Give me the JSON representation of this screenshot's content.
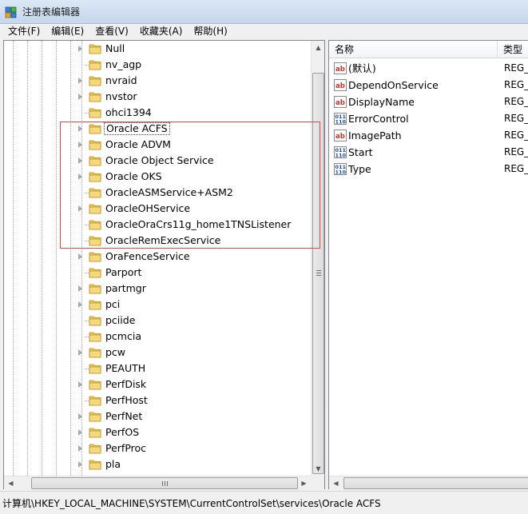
{
  "window": {
    "title": "注册表编辑器"
  },
  "menu": [
    "文件(F)",
    "编辑(E)",
    "查看(V)",
    "收藏夹(A)",
    "帮助(H)"
  ],
  "tree": {
    "items": [
      {
        "label": "Null",
        "expandable": true
      },
      {
        "label": "nv_agp",
        "expandable": false
      },
      {
        "label": "nvraid",
        "expandable": true
      },
      {
        "label": "nvstor",
        "expandable": true
      },
      {
        "label": "ohci1394",
        "expandable": false
      },
      {
        "label": "Oracle ACFS",
        "expandable": true,
        "selected": true
      },
      {
        "label": "Oracle ADVM",
        "expandable": true
      },
      {
        "label": "Oracle Object Service",
        "expandable": true
      },
      {
        "label": "Oracle OKS",
        "expandable": true
      },
      {
        "label": "OracleASMService+ASM2",
        "expandable": false
      },
      {
        "label": "OracleOHService",
        "expandable": true
      },
      {
        "label": "OracleOraCrs11g_home1TNSListener",
        "expandable": false
      },
      {
        "label": "OracleRemExecService",
        "expandable": false
      },
      {
        "label": "OraFenceService",
        "expandable": true
      },
      {
        "label": "Parport",
        "expandable": false
      },
      {
        "label": "partmgr",
        "expandable": true
      },
      {
        "label": "pci",
        "expandable": true
      },
      {
        "label": "pciide",
        "expandable": false
      },
      {
        "label": "pcmcia",
        "expandable": false
      },
      {
        "label": "pcw",
        "expandable": true
      },
      {
        "label": "PEAUTH",
        "expandable": false
      },
      {
        "label": "PerfDisk",
        "expandable": true
      },
      {
        "label": "PerfHost",
        "expandable": false
      },
      {
        "label": "PerfNet",
        "expandable": true
      },
      {
        "label": "PerfOS",
        "expandable": true
      },
      {
        "label": "PerfProc",
        "expandable": true
      },
      {
        "label": "pla",
        "expandable": true
      }
    ],
    "highlight_color": "#d84a4a"
  },
  "values": {
    "columns": [
      "名称",
      "类型"
    ],
    "rows": [
      {
        "name": "(默认)",
        "type": "REG_",
        "icon": "string-value-icon"
      },
      {
        "name": "DependOnService",
        "type": "REG_",
        "icon": "string-value-icon"
      },
      {
        "name": "DisplayName",
        "type": "REG_",
        "icon": "string-value-icon"
      },
      {
        "name": "ErrorControl",
        "type": "REG_",
        "icon": "binary-value-icon"
      },
      {
        "name": "ImagePath",
        "type": "REG_",
        "icon": "string-value-icon"
      },
      {
        "name": "Start",
        "type": "REG_",
        "icon": "binary-value-icon"
      },
      {
        "name": "Type",
        "type": "REG_",
        "icon": "binary-value-icon"
      }
    ]
  },
  "status": {
    "path": "计算机\\HKEY_LOCAL_MACHINE\\SYSTEM\\CurrentControlSet\\services\\Oracle ACFS"
  }
}
